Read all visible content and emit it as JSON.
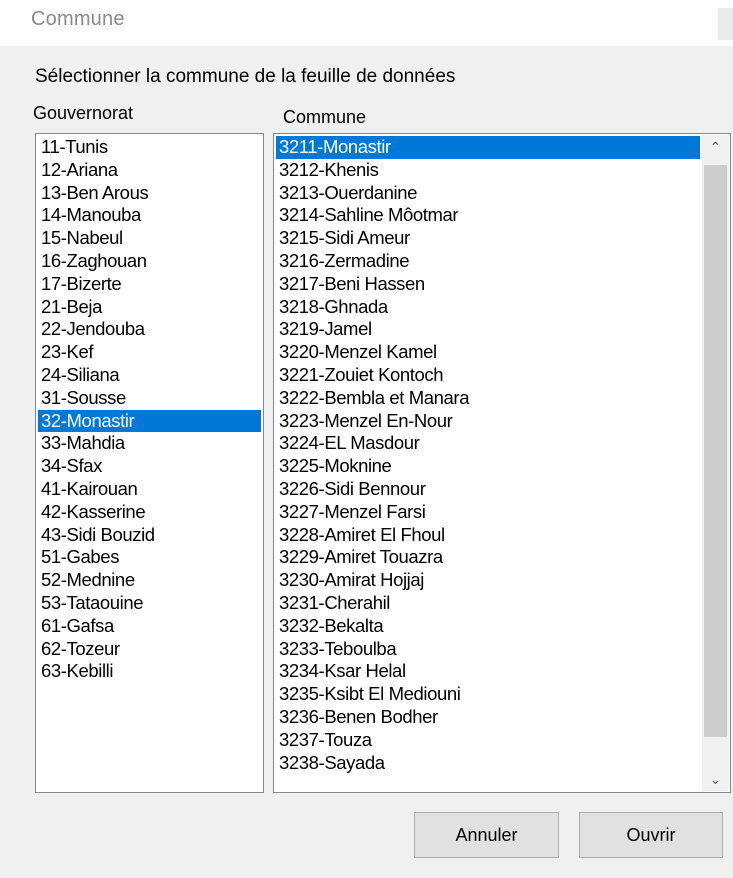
{
  "window": {
    "title": "Commune"
  },
  "dialog": {
    "prompt": "Sélectionner la commune de la feuille de données",
    "governorate_label": "Gouvernorat",
    "commune_label": "Commune"
  },
  "governorates": {
    "selected": "32-Monastir",
    "items": [
      "11-Tunis",
      "12-Ariana",
      "13-Ben Arous",
      "14-Manouba",
      "15-Nabeul",
      "16-Zaghouan",
      "17-Bizerte",
      "21-Beja",
      "22-Jendouba",
      "23-Kef",
      "24-Siliana",
      "31-Sousse",
      "32-Monastir",
      "33-Mahdia",
      "34-Sfax",
      "41-Kairouan",
      "42-Kasserine",
      "43-Sidi Bouzid",
      "51-Gabes",
      "52-Mednine",
      "53-Tataouine",
      "61-Gafsa",
      "62-Tozeur",
      "63-Kebilli"
    ]
  },
  "communes": {
    "selected": "3211-Monastir",
    "items": [
      "3211-Monastir",
      "3212-Khenis",
      "3213-Ouerdanine",
      "3214-Sahline Môotmar",
      "3215-Sidi Ameur",
      "3216-Zermadine",
      "3217-Beni Hassen",
      "3218-Ghnada",
      "3219-Jamel",
      "3220-Menzel Kamel",
      "3221-Zouiet Kontoch",
      "3222-Bembla et Manara",
      "3223-Menzel En-Nour",
      "3224-EL Masdour",
      "3225-Moknine",
      "3226-Sidi Bennour",
      "3227-Menzel Farsi",
      "3228-Amiret El Fhoul",
      "3229-Amiret Touazra",
      "3230-Amirat Hojjaj",
      "3231-Cherahil",
      "3232-Bekalta",
      "3233-Teboulba",
      "3234-Ksar Helal",
      "3235-Ksibt El Mediouni",
      "3236-Benen Bodher",
      "3237-Touza",
      "3238-Sayada"
    ]
  },
  "scrollbar": {
    "up_icon": "chevron-up-icon",
    "down_icon": "chevron-down-icon"
  },
  "buttons": {
    "cancel": "Annuler",
    "open": "Ouvrir"
  },
  "colors": {
    "selection": "#0078d7",
    "dialog_bg": "#f0f0f0"
  }
}
